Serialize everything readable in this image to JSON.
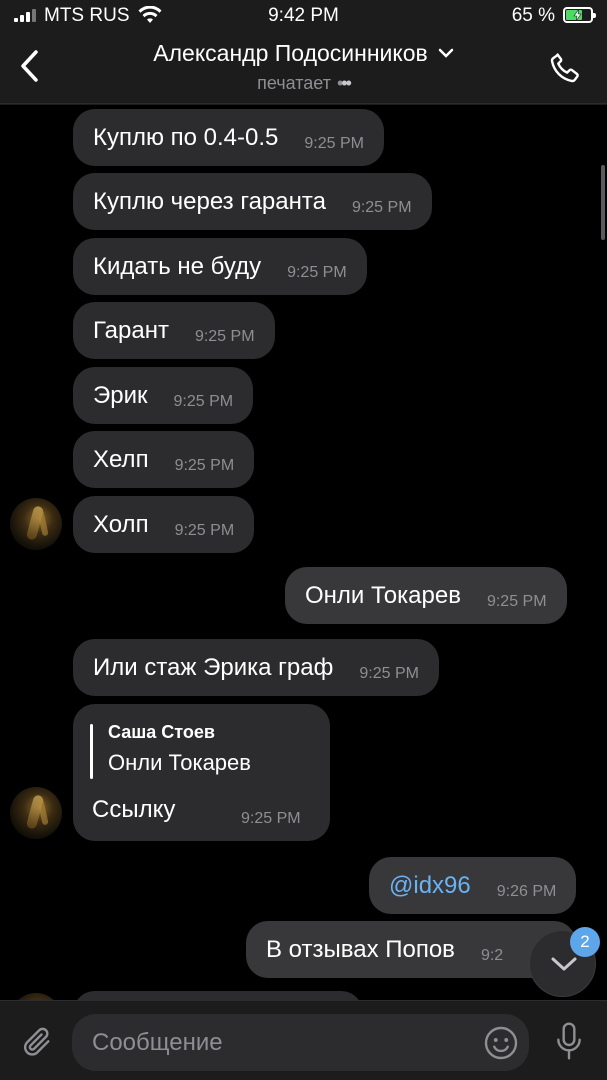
{
  "status_bar": {
    "carrier": "MTS RUS",
    "time": "9:42 PM",
    "battery": "65 %",
    "battery_level": 0.65,
    "icons": [
      "signal-icon",
      "wifi-icon",
      "battery-charging-icon"
    ]
  },
  "header": {
    "title": "Александр Подосинников",
    "subtitle": "печатает",
    "icons": [
      "back-icon",
      "chevron-down-icon",
      "phone-icon"
    ]
  },
  "messages": [
    {
      "text": "Куплю по 0.4-0.5",
      "time": "9:25 PM",
      "direction": "in"
    },
    {
      "text": "Куплю через гаранта",
      "time": "9:25 PM",
      "direction": "in"
    },
    {
      "text": "Кидать не буду",
      "time": "9:25 PM",
      "direction": "in"
    },
    {
      "text": "Гарант",
      "time": "9:25 PM",
      "direction": "in"
    },
    {
      "text": "Эрик",
      "time": "9:25 PM",
      "direction": "in"
    },
    {
      "text": "Хелп",
      "time": "9:25 PM",
      "direction": "in"
    },
    {
      "text": "Холп",
      "time": "9:25 PM",
      "direction": "in"
    },
    {
      "text": "Онли Токарев",
      "time": "9:25 PM",
      "direction": "out"
    },
    {
      "text": "Или стаж Эрика граф",
      "time": "9:25 PM",
      "direction": "in"
    },
    {
      "text": "@idx96",
      "time": "9:26 PM",
      "direction": "out"
    },
    {
      "text": "В отзывах Попов",
      "time": "9:2",
      "direction": "out"
    }
  ],
  "reply_message": {
    "quote_author": "Саша Стоев",
    "quote_text": "Онли Токарев",
    "text": "Ссылку",
    "time": "9:25 PM"
  },
  "scroll_down": {
    "badge": "2"
  },
  "input": {
    "placeholder": "Сообщение"
  },
  "colors": {
    "link": "#6ab2f2",
    "badge": "#5ea6ea",
    "bubble": "#2c2c2e",
    "background": "#000000"
  }
}
